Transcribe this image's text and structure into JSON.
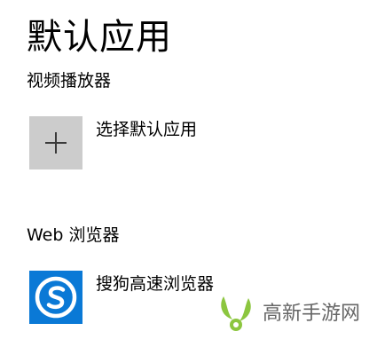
{
  "page": {
    "title": "默认应用"
  },
  "video_player": {
    "heading": "视频播放器",
    "app_label": "选择默认应用",
    "icon": "plus-icon"
  },
  "web_browser": {
    "heading": "Web 浏览器",
    "app_label": "搜狗高速浏览器",
    "icon": "sogou-browser-icon"
  },
  "watermark": {
    "text": "高新手游网",
    "icon": "gaoxin-logo-icon"
  },
  "colors": {
    "tile_gray": "#cccccc",
    "sogou_blue": "#0a79d6",
    "watermark_green": "#8cc63f",
    "watermark_text": "#666666"
  }
}
